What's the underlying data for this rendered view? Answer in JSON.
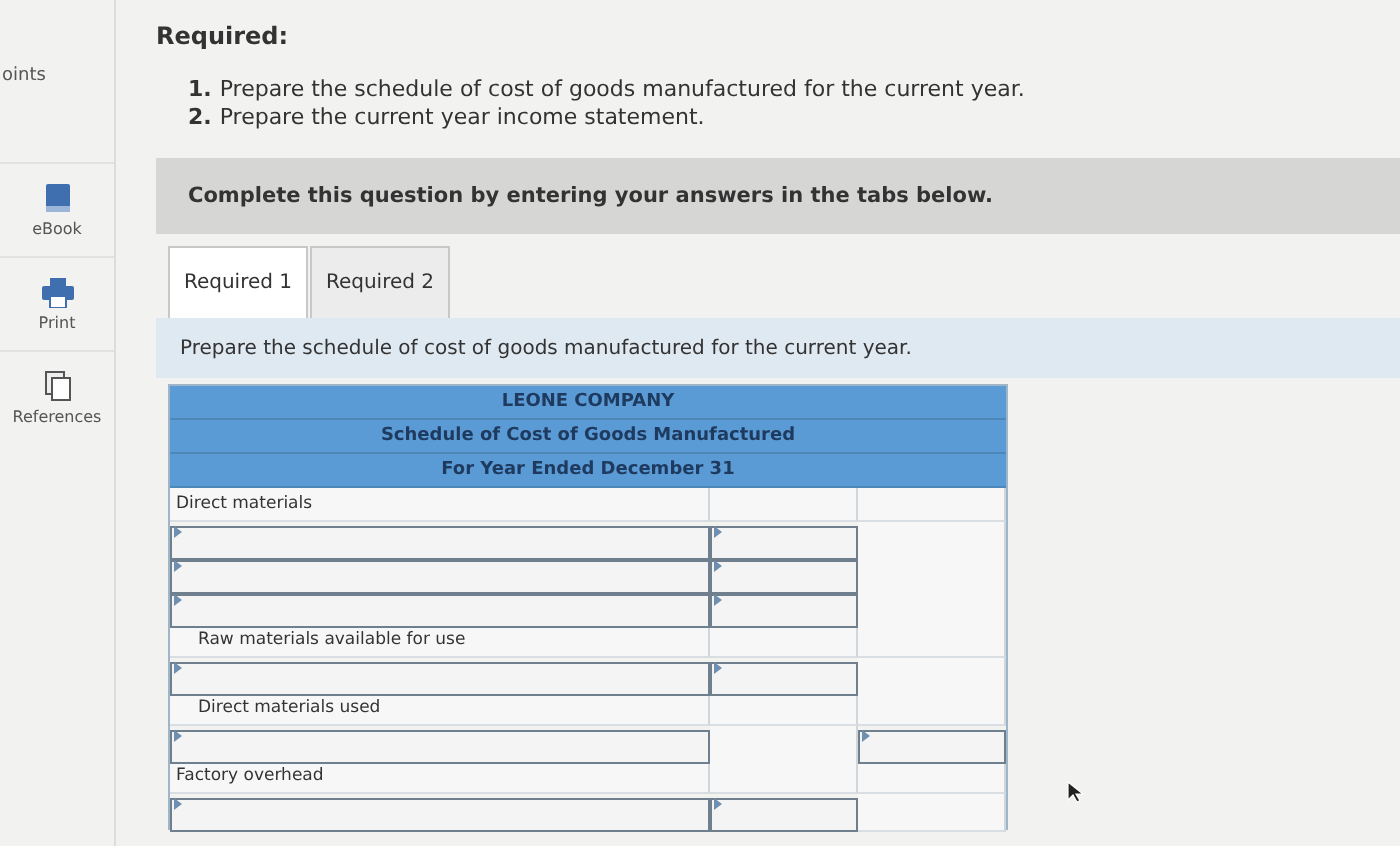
{
  "sidebar": {
    "points_label": "oints",
    "items": [
      {
        "kind": "book",
        "label": "eBook"
      },
      {
        "kind": "print",
        "label": "Print"
      },
      {
        "kind": "pages",
        "label": "References"
      }
    ]
  },
  "heading": "Required:",
  "tasks": [
    {
      "number": "1.",
      "text": "Prepare the schedule of cost of goods manufactured for the current year."
    },
    {
      "number": "2.",
      "text": "Prepare the current year income statement."
    }
  ],
  "banner": "Complete this question by entering your answers in the tabs below.",
  "tabs": [
    {
      "label": "Required 1",
      "selected": true
    },
    {
      "label": "Required 2",
      "selected": false
    }
  ],
  "instruction": "Prepare the schedule of cost of goods manufactured for the current year.",
  "table": {
    "title_rows": [
      "LEONE COMPANY",
      "Schedule of Cost of Goods Manufactured",
      "For Year Ended December 31"
    ],
    "rows": [
      {
        "kind": "label",
        "text": "Direct materials",
        "indented": false
      },
      {
        "kind": "inputs",
        "fields": [
          true,
          true,
          false
        ]
      },
      {
        "kind": "inputs",
        "fields": [
          true,
          true,
          false
        ]
      },
      {
        "kind": "inputs",
        "fields": [
          true,
          true,
          false
        ]
      },
      {
        "kind": "label",
        "text": "Raw materials available for use",
        "indented": true
      },
      {
        "kind": "inputs",
        "fields": [
          true,
          true,
          false
        ]
      },
      {
        "kind": "label",
        "text": "Direct materials used",
        "indented": true
      },
      {
        "kind": "inputs",
        "fields": [
          true,
          false,
          true
        ]
      },
      {
        "kind": "label",
        "text": "Factory overhead",
        "indented": false
      },
      {
        "kind": "inputs",
        "fields": [
          true,
          true,
          false
        ]
      }
    ]
  }
}
